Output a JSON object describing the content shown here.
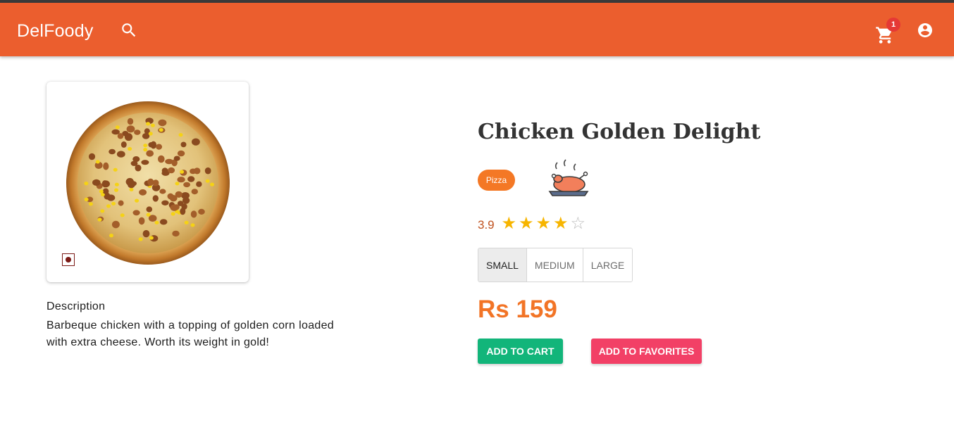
{
  "header": {
    "brand": "DelFoody",
    "cart_count": "1"
  },
  "product": {
    "title": "Chicken Golden Delight",
    "category": "Pizza",
    "rating": "3.9",
    "rating_value": 3.9,
    "stars": {
      "filled": 4,
      "total": 5
    },
    "sizes": [
      "SMALL",
      "MEDIUM",
      "LARGE"
    ],
    "selected_size": "SMALL",
    "price": "Rs 159",
    "description_title": "Description",
    "description": "Barbeque chicken with a topping of golden corn loaded with extra cheese. Worth its weight in gold!"
  },
  "actions": {
    "add_to_cart": "ADD TO CART",
    "add_to_favorites": "ADD TO FAVORITES"
  },
  "icons": {
    "search": "search-icon",
    "cart": "cart-icon",
    "account": "account-circle-icon",
    "non_veg": "non-veg-icon",
    "category_image": "roast-chicken-icon"
  },
  "colors": {
    "appbar": "#eb5e2e",
    "category_chip": "#f47825",
    "price": "#f27426",
    "star": "#f7b500",
    "cart_button": "#12b57a",
    "favorites_button": "#f24066",
    "badge": "#e53935"
  }
}
